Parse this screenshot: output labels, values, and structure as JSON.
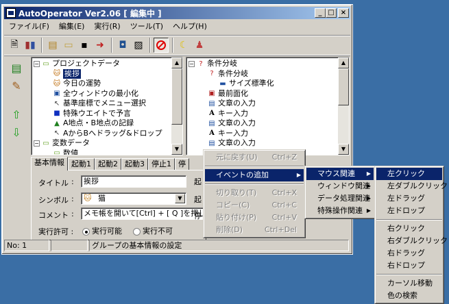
{
  "window": {
    "title": "AutoOperator Ver2.06  [ 編集中 ]",
    "min": "_",
    "max": "□",
    "close": "×"
  },
  "menubar": [
    "ファイル(F)",
    "編集(E)",
    "実行(R)",
    "ツール(T)",
    "ヘルプ(H)"
  ],
  "left_tree": [
    {
      "label": "プロジェクトデータ",
      "indent": 0,
      "icon": "folder-icon",
      "glyph": "▭",
      "exp": "−"
    },
    {
      "label": "挨拶",
      "indent": 1,
      "icon": "cat-icon",
      "glyph": "🐱",
      "selected": true
    },
    {
      "label": "今日の運勢",
      "indent": 1,
      "icon": "cat-icon",
      "glyph": "🐱"
    },
    {
      "label": "全ウィンドウの最小化",
      "indent": 1,
      "icon": "window-icon",
      "glyph": "▣"
    },
    {
      "label": "基準座標でメニュー選択",
      "indent": 1,
      "icon": "cursor-icon",
      "glyph": "↖"
    },
    {
      "label": "特殊ウエイトで予言",
      "indent": 1,
      "icon": "blue-square-icon",
      "glyph": "■"
    },
    {
      "label": "A地点・B地点の記録",
      "indent": 1,
      "icon": "pointer-icon",
      "glyph": "▲"
    },
    {
      "label": "AからBへドラッグ&ドロップ",
      "indent": 1,
      "icon": "cursor-icon",
      "glyph": "↖"
    },
    {
      "label": "変数データ",
      "indent": 0,
      "icon": "folder-icon",
      "glyph": "▭",
      "exp": "−"
    },
    {
      "label": "数値",
      "indent": 1,
      "icon": "folder-icon",
      "glyph": "▭"
    }
  ],
  "right_tree": [
    {
      "label": "条件分岐",
      "indent": 0,
      "icon": "question-icon",
      "glyph": "?",
      "exp": "−"
    },
    {
      "label": "条件分岐",
      "indent": 1,
      "icon": "question-icon",
      "glyph": "?"
    },
    {
      "label": "サイズ標準化",
      "indent": 2,
      "icon": "window-icon",
      "glyph": "▬"
    },
    {
      "label": "最前面化",
      "indent": 1,
      "icon": "front-icon",
      "glyph": "▣"
    },
    {
      "label": "文章の入力",
      "indent": 1,
      "icon": "doc-icon",
      "glyph": "▤"
    },
    {
      "label": "キー入力",
      "indent": 1,
      "icon": "key-a-icon",
      "glyph": "A"
    },
    {
      "label": "文章の入力",
      "indent": 1,
      "icon": "doc-icon",
      "glyph": "▤"
    },
    {
      "label": "キー入力",
      "indent": 1,
      "icon": "key-a-icon",
      "glyph": "A"
    },
    {
      "label": "文章の入力",
      "indent": 1,
      "icon": "doc-icon",
      "glyph": "▤"
    },
    {
      "label": "キー入力",
      "indent": 1,
      "icon": "key-a-icon",
      "glyph": "A"
    }
  ],
  "tabs": [
    "基本情報",
    "起動1",
    "起動2",
    "起動3",
    "停止1",
    "停"
  ],
  "form": {
    "title_label": "タイトル",
    "title_value": "挨拶",
    "symbol_label": "シンボル",
    "symbol_value": "猫",
    "comment_label": "コメント",
    "comment_value": "メモ帳を開いて[Ctrl] + [ Q ]を押して",
    "exec_label": "実行許可 :",
    "exec_on": "実行可能",
    "exec_off": "実行不可",
    "colon": ":",
    "right_partial_1": "起",
    "right_partial_2": "起",
    "right_partial_3": "停"
  },
  "status": {
    "no": "No: 1",
    "msg": "グループの基本情報の設定"
  },
  "context_menu": [
    {
      "label": "元に戻す(U)",
      "shortcut": "Ctrl+Z",
      "disabled": true
    },
    {
      "sep": true
    },
    {
      "label": "イベントの追加",
      "submenu": true,
      "highlight": true
    },
    {
      "sep": true
    },
    {
      "label": "切り取り(T)",
      "shortcut": "Ctrl+X",
      "disabled": true
    },
    {
      "label": "コピー(C)",
      "shortcut": "Ctrl+C",
      "disabled": true
    },
    {
      "label": "貼り付け(P)",
      "shortcut": "Ctrl+V",
      "disabled": true
    },
    {
      "label": "削除(D)",
      "shortcut": "Ctrl+Del",
      "disabled": true
    }
  ],
  "submenu_1": [
    {
      "label": "マウス関連",
      "highlight": true
    },
    {
      "label": "ウィンドウ関連"
    },
    {
      "label": "データ処理関連"
    },
    {
      "label": "特殊操作関連"
    }
  ],
  "submenu_2": [
    {
      "label": "左クリック",
      "highlight": true
    },
    {
      "label": "左ダブルクリック"
    },
    {
      "label": "左ドラッグ"
    },
    {
      "label": "左ドロップ"
    },
    {
      "sep": true
    },
    {
      "label": "右クリック"
    },
    {
      "label": "右ダブルクリック"
    },
    {
      "label": "右ドラッグ"
    },
    {
      "label": "右ドロップ"
    },
    {
      "sep": true
    },
    {
      "label": "カーソル移動"
    },
    {
      "label": "色の検索"
    }
  ]
}
